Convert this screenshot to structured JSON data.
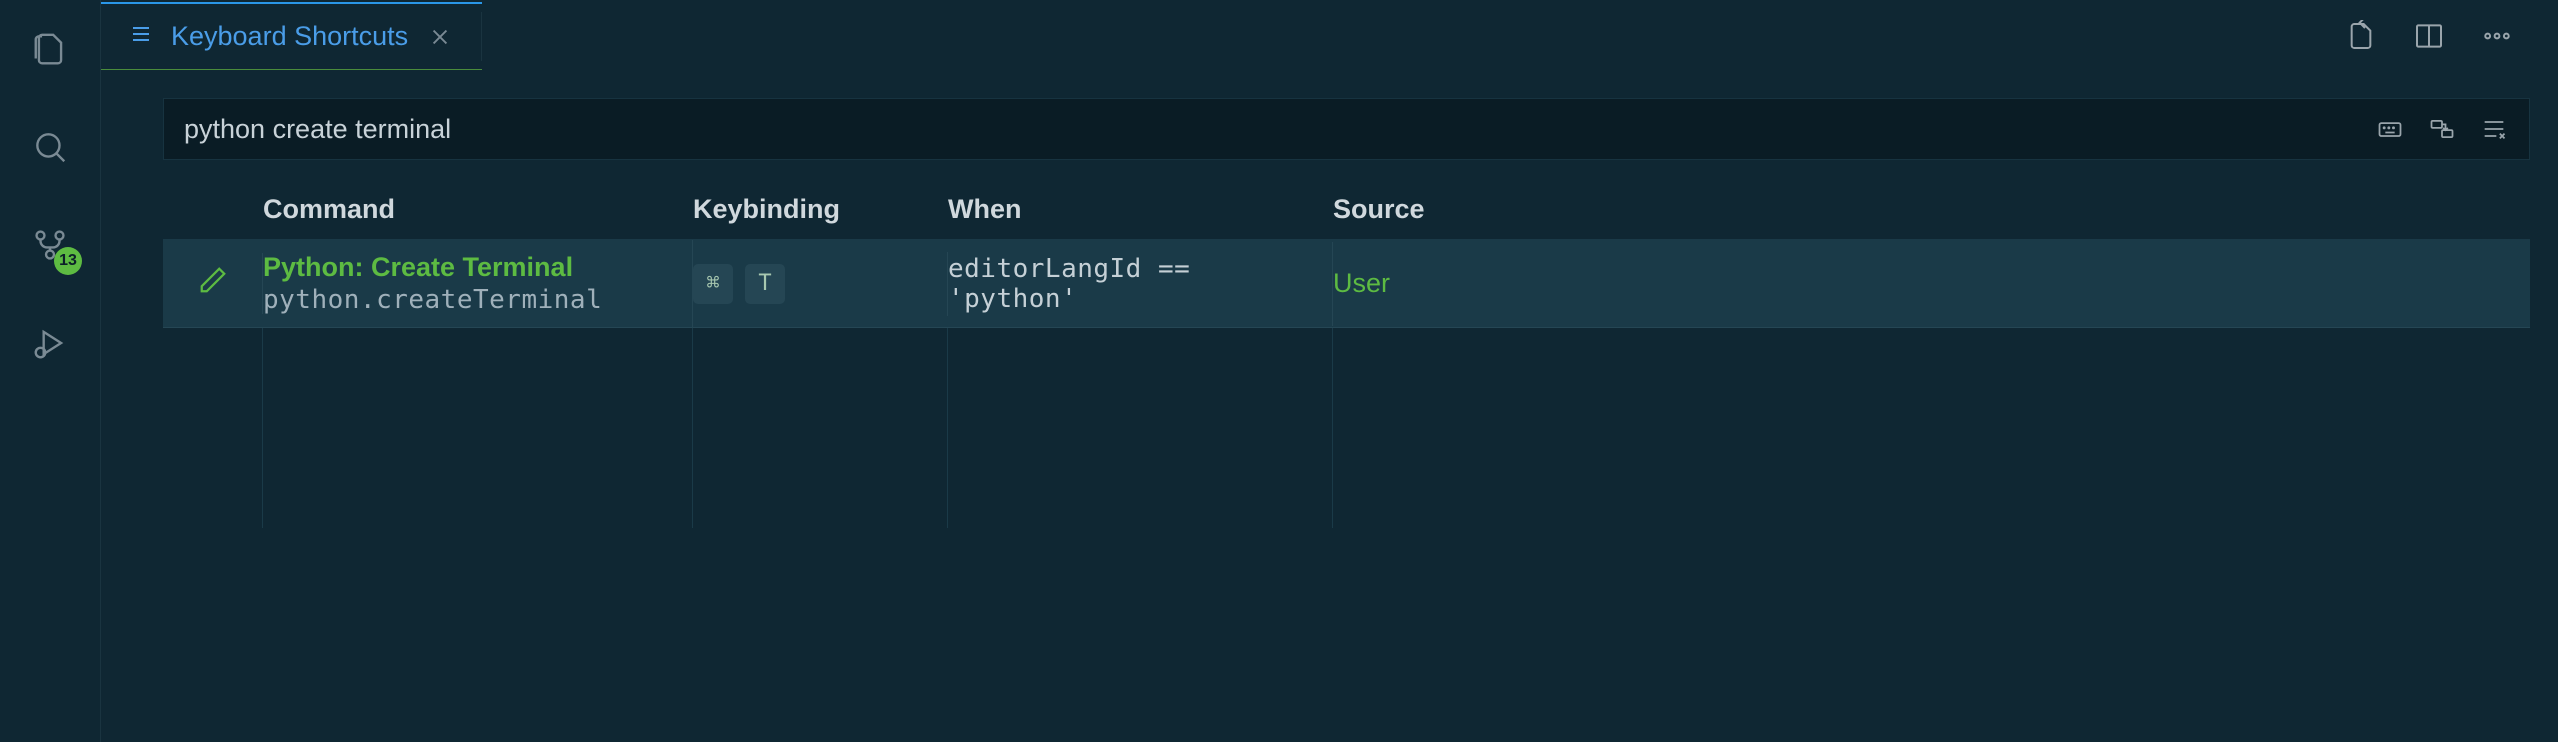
{
  "activity_bar": {
    "scm_badge": "13"
  },
  "tab": {
    "label": "Keyboard Shortcuts"
  },
  "search": {
    "value": "python create terminal"
  },
  "columns": {
    "command": "Command",
    "keybinding": "Keybinding",
    "when": "When",
    "source": "Source"
  },
  "rows": [
    {
      "title": "Python: Create Terminal",
      "id": "python.createTerminal",
      "keys": [
        "⌘",
        "T"
      ],
      "when": "editorLangId == 'python'",
      "source": "User"
    }
  ]
}
